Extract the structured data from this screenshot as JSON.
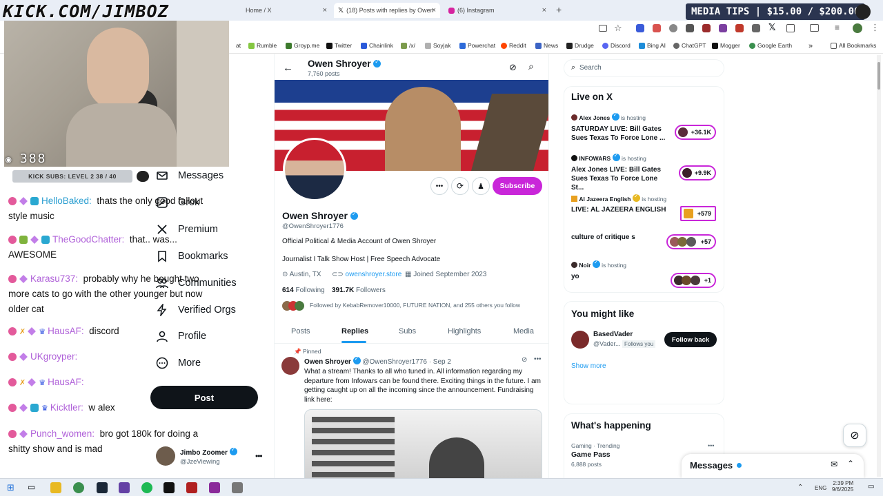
{
  "stream": {
    "kick_url": "KICK.COM/JIMBOZ",
    "viewer_count": "388",
    "subs_goal": "KICK SUBS: LEVEL 2 38 / 40",
    "media_tips": "MEDIA TIPS | $15.00 / $200.00"
  },
  "browser": {
    "tabs": [
      {
        "label": "Home / X"
      },
      {
        "label": "(18) Posts with replies by Owen"
      },
      {
        "label": "(6) Instagram"
      }
    ],
    "bookmarks": [
      "Rumble",
      "Groyp.me",
      "Twitter",
      "Chainlink",
      "/x/",
      "Soyjak",
      "Powerchat",
      "Reddit",
      "News",
      "Drudge",
      "Discord",
      "Bing AI",
      "ChatGPT",
      "Mogger",
      "Google Earth"
    ],
    "all_bookmarks": "All Bookmarks",
    "bookmark_prefix": "at"
  },
  "chat": [
    {
      "user": "HelloBaked:",
      "text": "thats the only good fallout style music",
      "color": "#2c9fd1"
    },
    {
      "user": "TheGoodChatter:",
      "text": "that.. was... AWESOME",
      "color": "#b062d9"
    },
    {
      "user": "Karasu737:",
      "text": "probably why he bought two more cats to go with the other younger but now older cat",
      "color": "#b062d9"
    },
    {
      "user": "HausAF:",
      "text": "discord",
      "color": "#b062d9"
    },
    {
      "user": "UKgroyper:",
      "text": "",
      "color": "#b062d9"
    },
    {
      "user": "HausAF:",
      "text": "",
      "color": "#b062d9"
    },
    {
      "user": "Kicktler:",
      "text": "w alex",
      "color": "#b062d9"
    },
    {
      "user": "Punch_women:",
      "text": "bro got 180k for doing a shitty show and is mad",
      "color": "#b062d9"
    }
  ],
  "nav": {
    "items": [
      "Messages",
      "Grok",
      "Premium",
      "Bookmarks",
      "Communities",
      "Verified Orgs",
      "Profile",
      "More"
    ],
    "post_button": "Post",
    "account_name": "Jimbo Zoomer",
    "account_handle": "@JzeViewing"
  },
  "profile": {
    "header_name": "Owen Shroyer",
    "post_count": "7,760 posts",
    "name": "Owen Shroyer",
    "handle": "@OwenShroyer1776",
    "bio_line1": "Official Political & Media Account of Owen Shroyer",
    "bio_line2": "Journalist I Talk Show Host | Free Speech Advocate",
    "location": "Austin, TX",
    "website": "owenshroyer.store",
    "joined": "Joined September 2023",
    "following_count": "614",
    "following_label": "Following",
    "followers_count": "391.7K",
    "followers_label": "Followers",
    "followed_by": "Followed by KebabRemover10000, FUTURE NATION, and 255 others you follow",
    "subscribe_label": "Subscribe",
    "tabs": [
      "Posts",
      "Replies",
      "Subs",
      "Highlights",
      "Media"
    ]
  },
  "pinned_post": {
    "pinned_label": "Pinned",
    "author": "Owen Shroyer",
    "handle_date": "@OwenShroyer1776 · Sep 2",
    "text": "What a stream! Thanks to all who tuned in. All information regarding my departure from Infowars can be found there. Exciting things in the future. I am getting caught up on all the incoming since the announcement. Fundraising link here:"
  },
  "sidebar": {
    "search_placeholder": "Search",
    "live_title": "Live on X",
    "live": [
      {
        "host": "Alex Jones",
        "hosting": "is hosting",
        "title": "SATURDAY LIVE: Bill Gates Sues Texas To Force Lone ...",
        "count": "+36.1K"
      },
      {
        "host": "INFOWARS",
        "hosting": "is hosting",
        "title": "Alex Jones LIVE: Bill Gates Sues Texas To Force Lone St...",
        "count": "+9.9K"
      },
      {
        "host": "Al Jazeera English",
        "hosting": "is hosting",
        "title": "LIVE: AL JAZEERA ENGLISH",
        "count": "+579"
      },
      {
        "host": "",
        "hosting": "",
        "title": "culture of critique s",
        "count": "+57"
      },
      {
        "host": "Noir",
        "hosting": "is hosting",
        "title": "yo",
        "count": "+1"
      }
    ],
    "might_like_title": "You might like",
    "suggestion_name": "BasedVader",
    "suggestion_handle": "@Vader...",
    "follows_you": "Follows you",
    "follow_back": "Follow back",
    "show_more": "Show more",
    "happening_title": "What's happening",
    "trend_category": "Gaming · Trending",
    "trend_name": "Game Pass",
    "trend_posts": "6,888 posts",
    "messages_label": "Messages"
  },
  "taskbar": {
    "lang": "ENG",
    "time": "2:39 PM",
    "date": "9/6/2025"
  },
  "colors": {
    "subscribe": "#c926d9",
    "link": "#1d9bf0",
    "verified": "#1d9bf0"
  }
}
